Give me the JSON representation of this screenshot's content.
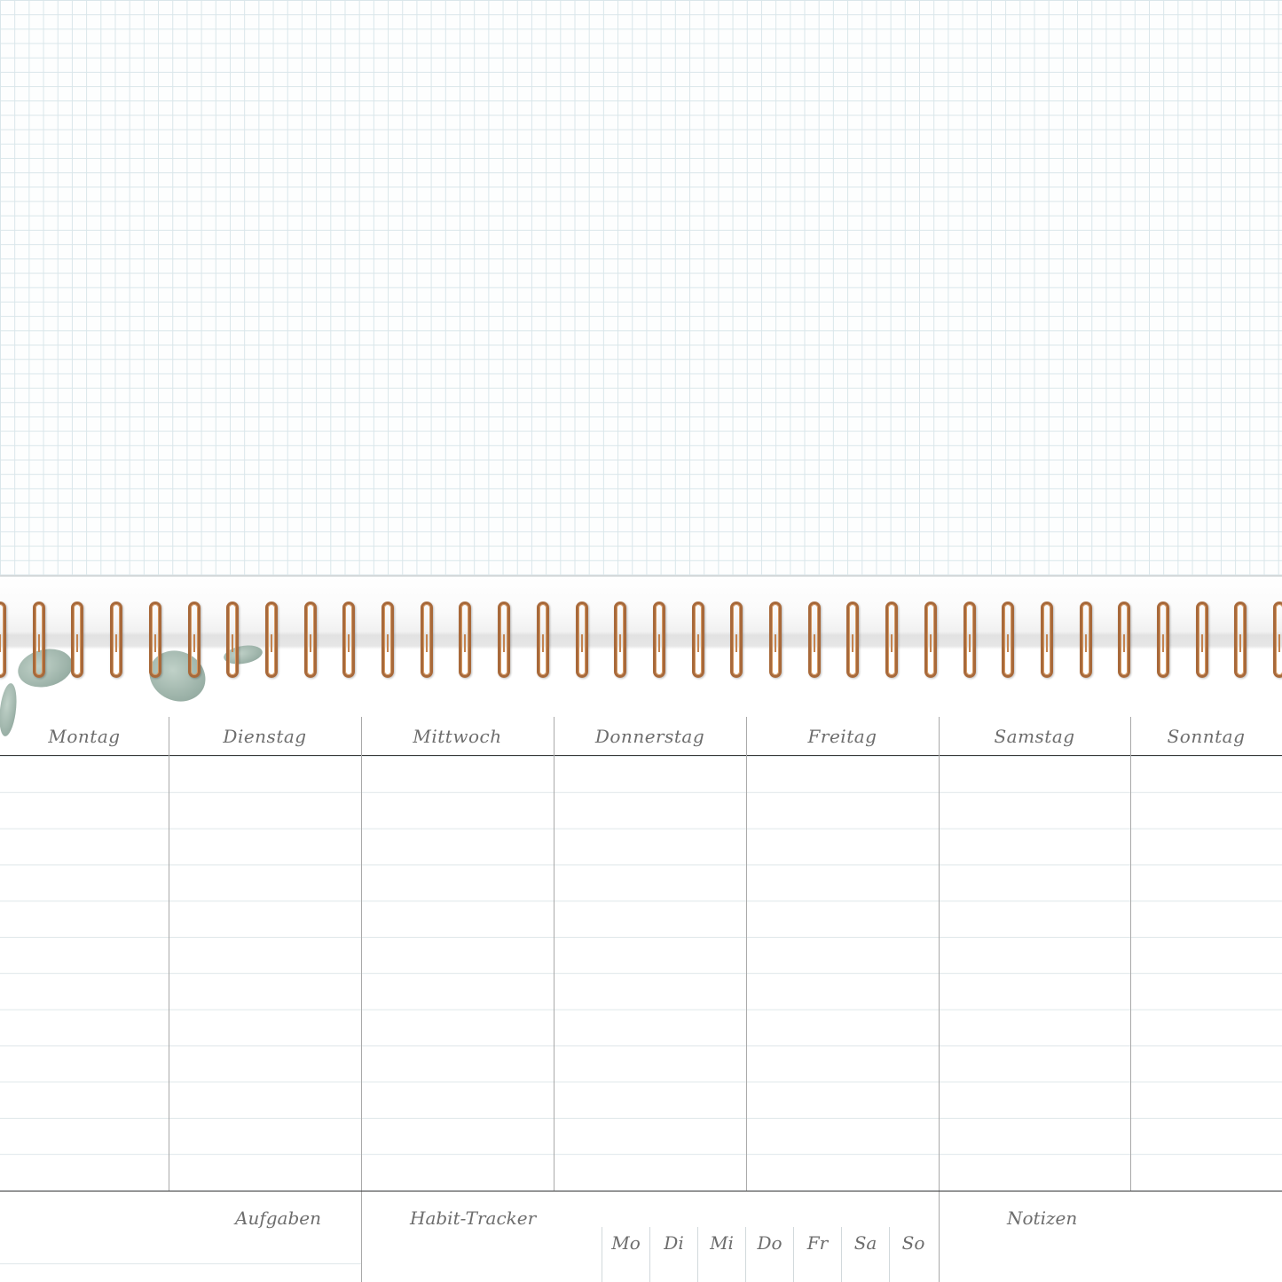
{
  "planner": {
    "days": [
      "Montag",
      "Dienstag",
      "Mittwoch",
      "Donnerstag",
      "Freitag",
      "Samstag",
      "Sonntag"
    ],
    "sections": {
      "tasks": "Aufgaben",
      "habit_tracker": "Habit-Tracker",
      "notes": "Notizen"
    },
    "tracker_days": [
      "Mo",
      "Di",
      "Mi",
      "Do",
      "Fr",
      "Sa",
      "So"
    ]
  },
  "colors": {
    "grid_line": "#d9e6ea",
    "ring": "#a8693a",
    "leaf": "#8ea79c",
    "text": "#6d6d6d"
  },
  "icons": [
    "spiral-binding-ring",
    "eucalyptus-leaf"
  ]
}
